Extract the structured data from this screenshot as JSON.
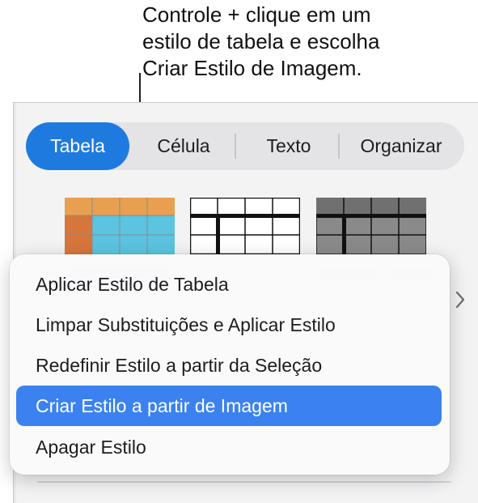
{
  "callout": {
    "lines": [
      "Controle + clique em um",
      "estilo de tabela e escolha",
      "Criar Estilo de Imagem."
    ]
  },
  "tabs": [
    {
      "label": "Tabela",
      "active": true
    },
    {
      "label": "Célula",
      "active": false
    },
    {
      "label": "Texto",
      "active": false
    },
    {
      "label": "Organizar",
      "active": false
    }
  ],
  "table_styles": [
    {
      "name": "orange-blue-style",
      "header_color": "#e8a050",
      "body_color": "#5bc4e0",
      "column_color": "#d7763b"
    },
    {
      "name": "black-white-lines-style",
      "header_color": "#ffffff",
      "body_color": "#ffffff",
      "line_color": "#111111"
    },
    {
      "name": "gray-style",
      "header_color": "#707070",
      "body_color": "#8a8a8a",
      "line_color": "#111111"
    }
  ],
  "context_menu": {
    "items": [
      {
        "label": "Aplicar Estilo de Tabela",
        "highlighted": false
      },
      {
        "label": "Limpar Substituições e Aplicar Estilo",
        "highlighted": false
      },
      {
        "label": "Redefinir Estilo a partir da Seleção",
        "highlighted": false
      },
      {
        "label": "Criar Estilo a partir de Imagem",
        "highlighted": true
      },
      {
        "label": "Apagar Estilo",
        "highlighted": false
      }
    ]
  },
  "colors": {
    "accent": "#1f7ae0",
    "menu_highlight": "#3b82f0"
  }
}
